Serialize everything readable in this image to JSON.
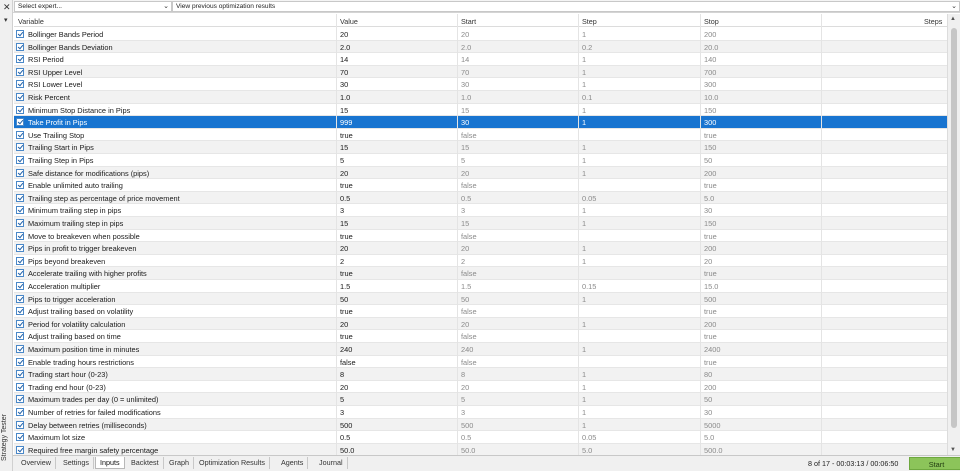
{
  "window": {
    "side_title": "Strategy Tester"
  },
  "topbar": {
    "expert_select": "Select expert...",
    "results_select": "View previous optimization results"
  },
  "columns": {
    "variable": "Variable",
    "value": "Value",
    "start": "Start",
    "step": "Step",
    "stop": "Stop",
    "steps": "Steps"
  },
  "rows": [
    {
      "variable": "Bollinger Bands Period",
      "value": "20",
      "start": "20",
      "step": "1",
      "stop": "200"
    },
    {
      "variable": "Bollinger Bands Deviation",
      "value": "2.0",
      "start": "2.0",
      "step": "0.2",
      "stop": "20.0"
    },
    {
      "variable": "RSI Period",
      "value": "14",
      "start": "14",
      "step": "1",
      "stop": "140"
    },
    {
      "variable": "RSI Upper Level",
      "value": "70",
      "start": "70",
      "step": "1",
      "stop": "700"
    },
    {
      "variable": "RSI Lower Level",
      "value": "30",
      "start": "30",
      "step": "1",
      "stop": "300"
    },
    {
      "variable": "Risk Percent",
      "value": "1.0",
      "start": "1.0",
      "step": "0.1",
      "stop": "10.0"
    },
    {
      "variable": "Minimum Stop Distance in Pips",
      "value": "15",
      "start": "15",
      "step": "1",
      "stop": "150"
    },
    {
      "variable": "Take Profit in Pips",
      "value": "999",
      "start": "30",
      "step": "1",
      "stop": "300"
    },
    {
      "variable": "Use Trailing Stop",
      "value": "true",
      "start": "false",
      "step": "",
      "stop": "true"
    },
    {
      "variable": "Trailing Start in Pips",
      "value": "15",
      "start": "15",
      "step": "1",
      "stop": "150"
    },
    {
      "variable": "Trailing Step in Pips",
      "value": "5",
      "start": "5",
      "step": "1",
      "stop": "50"
    },
    {
      "variable": "Safe distance for modifications (pips)",
      "value": "20",
      "start": "20",
      "step": "1",
      "stop": "200"
    },
    {
      "variable": "Enable unlimited auto trailing",
      "value": "true",
      "start": "false",
      "step": "",
      "stop": "true"
    },
    {
      "variable": "Trailing step as percentage of price movement",
      "value": "0.5",
      "start": "0.5",
      "step": "0.05",
      "stop": "5.0"
    },
    {
      "variable": "Minimum trailing step in pips",
      "value": "3",
      "start": "3",
      "step": "1",
      "stop": "30"
    },
    {
      "variable": "Maximum trailing step in pips",
      "value": "15",
      "start": "15",
      "step": "1",
      "stop": "150"
    },
    {
      "variable": "Move to breakeven when possible",
      "value": "true",
      "start": "false",
      "step": "",
      "stop": "true"
    },
    {
      "variable": "Pips in profit to trigger breakeven",
      "value": "20",
      "start": "20",
      "step": "1",
      "stop": "200"
    },
    {
      "variable": "Pips beyond breakeven",
      "value": "2",
      "start": "2",
      "step": "1",
      "stop": "20"
    },
    {
      "variable": "Accelerate trailing with higher profits",
      "value": "true",
      "start": "false",
      "step": "",
      "stop": "true"
    },
    {
      "variable": "Acceleration multiplier",
      "value": "1.5",
      "start": "1.5",
      "step": "0.15",
      "stop": "15.0"
    },
    {
      "variable": "Pips to trigger acceleration",
      "value": "50",
      "start": "50",
      "step": "1",
      "stop": "500"
    },
    {
      "variable": "Adjust trailing based on volatility",
      "value": "true",
      "start": "false",
      "step": "",
      "stop": "true"
    },
    {
      "variable": "Period for volatility calculation",
      "value": "20",
      "start": "20",
      "step": "1",
      "stop": "200"
    },
    {
      "variable": "Adjust trailing based on time",
      "value": "true",
      "start": "false",
      "step": "",
      "stop": "true"
    },
    {
      "variable": "Maximum position time in minutes",
      "value": "240",
      "start": "240",
      "step": "1",
      "stop": "2400"
    },
    {
      "variable": "Enable trading hours restrictions",
      "value": "false",
      "start": "false",
      "step": "",
      "stop": "true"
    },
    {
      "variable": "Trading start hour (0-23)",
      "value": "8",
      "start": "8",
      "step": "1",
      "stop": "80"
    },
    {
      "variable": "Trading end hour (0-23)",
      "value": "20",
      "start": "20",
      "step": "1",
      "stop": "200"
    },
    {
      "variable": "Maximum trades per day (0 = unlimited)",
      "value": "5",
      "start": "5",
      "step": "1",
      "stop": "50"
    },
    {
      "variable": "Number of retries for failed modifications",
      "value": "3",
      "start": "3",
      "step": "1",
      "stop": "30"
    },
    {
      "variable": "Delay between retries (milliseconds)",
      "value": "500",
      "start": "500",
      "step": "1",
      "stop": "5000"
    },
    {
      "variable": "Maximum lot size",
      "value": "0.5",
      "start": "0.5",
      "step": "0.05",
      "stop": "5.0"
    },
    {
      "variable": "Required free margin safety percentage",
      "value": "50.0",
      "start": "50.0",
      "step": "5.0",
      "stop": "500.0"
    }
  ],
  "selected_row": 7,
  "tabs": [
    "Overview",
    "Settings",
    "Inputs",
    "Backtest",
    "Graph",
    "Optimization Results",
    "Agents",
    "Journal"
  ],
  "active_tab": "Inputs",
  "status": {
    "progress": "8 of 17",
    "time": "00:03:13 / 00:06:50"
  },
  "start_button": "Start",
  "colors": {
    "selection": "#1874d0",
    "start_button": "#8cc45a"
  }
}
